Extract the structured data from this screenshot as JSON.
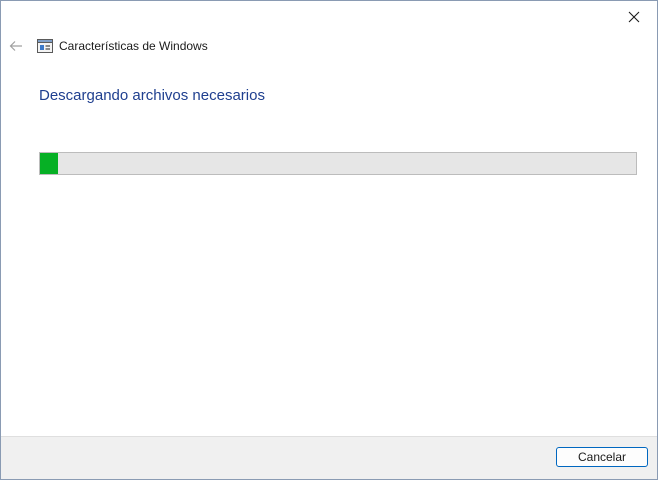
{
  "window": {
    "title": "Características de Windows",
    "icon": "windows-features-icon",
    "close_icon": "close-icon",
    "back_icon": "back-arrow-icon"
  },
  "main": {
    "heading": "Descargando archivos necesarios",
    "progress": {
      "value_percent": 3,
      "color": "#06b025"
    }
  },
  "footer": {
    "cancel_label": "Cancelar"
  },
  "colors": {
    "heading": "#1f3f8f",
    "accent": "#0067c0"
  }
}
